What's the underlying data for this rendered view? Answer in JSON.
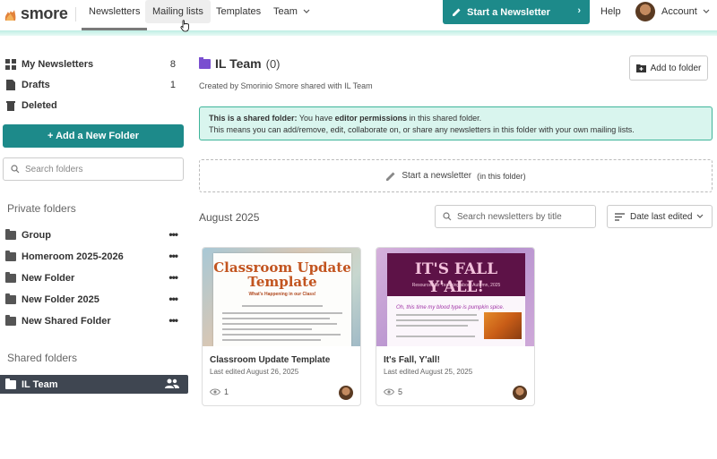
{
  "brand": {
    "name": "smore",
    "accent": "#1d8a8a",
    "folder_accent": "#7a4fd0"
  },
  "nav": {
    "items": [
      "Newsletters",
      "Mailing lists",
      "Templates",
      "Team"
    ],
    "start_button": "Start a Newsletter",
    "help": "Help",
    "account": "Account"
  },
  "sidebar": {
    "my_newsletters": {
      "label": "My Newsletters",
      "count": "8"
    },
    "drafts": {
      "label": "Drafts",
      "count": "1"
    },
    "deleted": {
      "label": "Deleted"
    },
    "add_folder_button": "+ Add a New Folder",
    "search_placeholder": "Search folders",
    "private_title": "Private folders",
    "private_folders": [
      "Group",
      "Homeroom 2025-2026",
      "New Folder",
      "New Folder 2025",
      "New Shared Folder"
    ],
    "shared_title": "Shared folders",
    "shared_folders": [
      "IL Team"
    ],
    "more_icon": "•••"
  },
  "main": {
    "title": "IL Team",
    "count": "(0)",
    "created_by": "Created by Smorinio Smore shared with IL Team",
    "add_to_folder": "Add to folder",
    "banner": {
      "bold1": "This is a shared folder:",
      "text1": " You have ",
      "bold2": "editor permissions",
      "text2": " in this shared folder.",
      "line2": "This means you can add/remove, edit, collaborate on, or share any newsletters in this folder with your own mailing lists."
    },
    "start_in_folder": "Start a newsletter",
    "start_in_folder_suffix": "(in this folder)",
    "month": "August 2025",
    "search_placeholder": "Search newsletters by title",
    "sort_label": "Date last edited"
  },
  "cards": [
    {
      "title": "Classroom Update Template",
      "date": "Last edited August 26, 2025",
      "views": "1",
      "thumb_title": "Classroom Update Template",
      "thumb_sub": "What's Happening in our Class!"
    },
    {
      "title": "It's Fall, Y'all!",
      "date": "Last edited August 25, 2025",
      "views": "5",
      "thumb_title": "IT'S FALL Y'ALL!",
      "thumb_sub": "Resources for Teaching about Autumn, 2025",
      "thumb_script": "Oh, this time my blood type is pumpkin spice."
    }
  ]
}
